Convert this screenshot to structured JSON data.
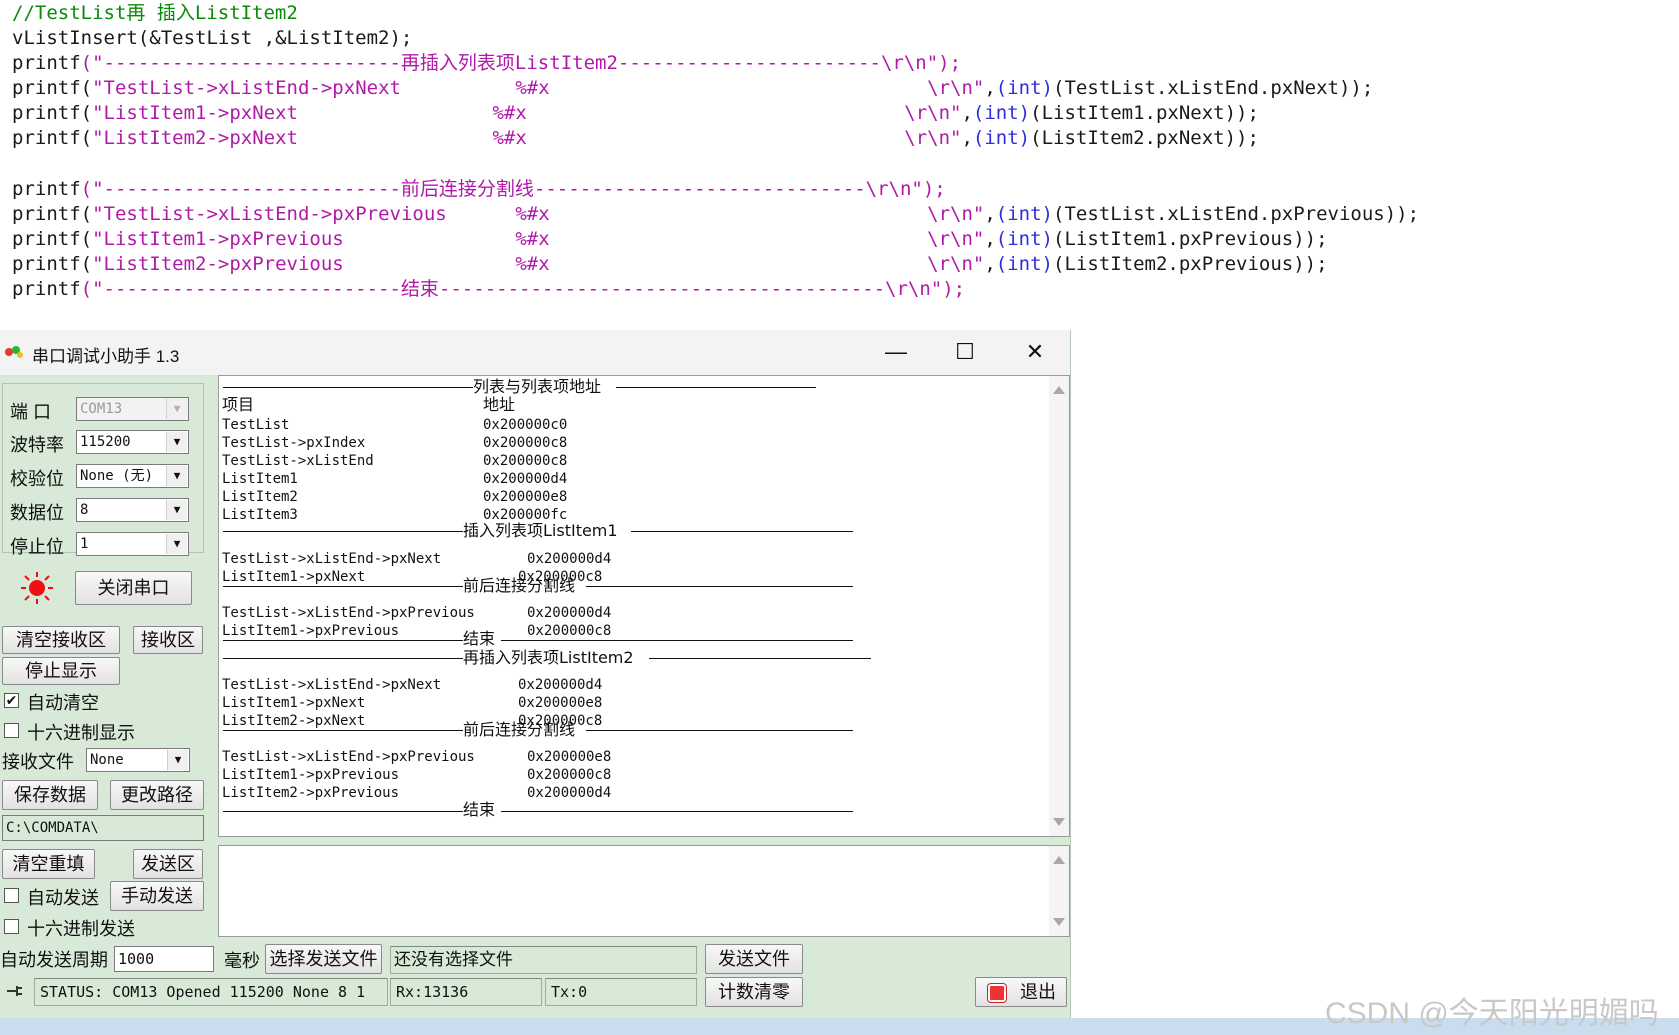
{
  "code": {
    "comment": "//TestList再 插入ListItem2",
    "insert_line": "vListInsert(&TestList ,&ListItem2);",
    "printf": "printf",
    "header_insert2": "(\"--------------------------再插入列表项ListItem2-----------------------\\r\\n\");",
    "l1_str": "\"TestList->xListEnd->pxNext          %#x                                 \\r\\n\"",
    "l1_tail": "(TestList.xListEnd.pxNext));",
    "l2_str": "\"ListItem1->pxNext                 %#x                                 \\r\\n\"",
    "l2_tail": "(ListItem1.pxNext));",
    "l3_str": "\"ListItem2->pxNext                 %#x                                 \\r\\n\"",
    "l3_tail": "(ListItem2.pxNext));",
    "header_sep": "(\"--------------------------前后连接分割线-----------------------------\\r\\n\");",
    "p1_str": "\"TestList->xListEnd->pxPrevious      %#x                                 \\r\\n\"",
    "p1_tail": "(TestList.xListEnd.pxPrevious));",
    "p2_str": "\"ListItem1->pxPrevious               %#x                                 \\r\\n\"",
    "p2_tail": "(ListItem1.pxPrevious));",
    "p3_str": "\"ListItem2->pxPrevious               %#x                                 \\r\\n\"",
    "p3_tail": "(ListItem2.pxPrevious));",
    "footer": "(\"--------------------------结束---------------------------------------\\r\\n\");",
    "int_kw": "(int)",
    "comma": ",",
    "open_paren": "("
  },
  "window": {
    "title": "串口调试小助手 1.3",
    "minimize": "—",
    "maximize": "☐",
    "close": "✕"
  },
  "settings": {
    "port_label": "端  口",
    "port_value": "COM13",
    "baud_label": "波特率",
    "baud_value": "115200",
    "parity_label": "校验位",
    "parity_value": "None (无)",
    "databits_label": "数据位",
    "databits_value": "8",
    "stopbits_label": "停止位",
    "stopbits_value": "1",
    "close_port_button": "关闭串口"
  },
  "receive_controls": {
    "clear_button": "清空接收区",
    "area_button": "接收区",
    "stop_display_button": "停止显示",
    "auto_clear_label": "自动清空",
    "auto_clear_checked": "✔",
    "hex_display_label": "十六进制显示",
    "recv_file_label": "接收文件",
    "recv_file_value": "None",
    "save_data_button": "保存数据",
    "change_path_button": "更改路径",
    "path_value": "C:\\COMDATA\\"
  },
  "receive_area": {
    "h_list": "列表与列表项地址",
    "col_item": "项目",
    "col_addr": "地址",
    "rows1": [
      {
        "k": "TestList",
        "v": "0x200000c0"
      },
      {
        "k": "TestList->pxIndex",
        "v": "0x200000c8"
      },
      {
        "k": "TestList->xListEnd",
        "v": "0x200000c8"
      },
      {
        "k": "ListItem1",
        "v": "0x200000d4"
      },
      {
        "k": "ListItem2",
        "v": "0x200000e8"
      },
      {
        "k": "ListItem3",
        "v": "0x200000fc"
      }
    ],
    "h_insert1": "插入列表项ListItem1",
    "rows2": [
      {
        "k": "TestList->xListEnd->pxNext",
        "v": "0x200000d4"
      },
      {
        "k": "ListItem1->pxNext",
        "v": "0x200000c8"
      }
    ],
    "h_sep1": "前后连接分割线",
    "rows3": [
      {
        "k": "TestList->xListEnd->pxPrevious",
        "v": "0x200000d4"
      },
      {
        "k": "ListItem1->pxPrevious",
        "v": "0x200000c8"
      }
    ],
    "h_end1": "结束",
    "h_insert2": "再插入列表项ListItem2",
    "rows4": [
      {
        "k": "TestList->xListEnd->pxNext",
        "v": "0x200000d4"
      },
      {
        "k": "ListItem1->pxNext",
        "v": "0x200000e8"
      },
      {
        "k": "ListItem2->pxNext",
        "v": "0x200000c8"
      }
    ],
    "h_sep2": "前后连接分割线",
    "rows5": [
      {
        "k": "TestList->xListEnd->pxPrevious",
        "v": "0x200000e8"
      },
      {
        "k": "ListItem1->pxPrevious",
        "v": "0x200000c8"
      },
      {
        "k": "ListItem2->pxPrevious",
        "v": "0x200000d4"
      }
    ],
    "h_end2": "结束"
  },
  "send_controls": {
    "clear_resend_button": "清空重填",
    "send_area_button": "发送区",
    "auto_send_label": "自动发送",
    "manual_send_button": "手动发送",
    "hex_send_label": "十六进制发送",
    "period_label": "自动发送周期",
    "period_value": "1000",
    "ms_label": "毫秒",
    "choose_file_button": "选择发送文件",
    "no_file_text": "还没有选择文件",
    "send_file_button": "发送文件",
    "reset_count_button": "计数清零",
    "exit_button": "退出"
  },
  "status": {
    "status_text": "STATUS: COM13 Opened 115200 None  8 1",
    "rx_text": "Rx:13136",
    "tx_text": "Tx:0"
  },
  "watermark": "CSDN @今天阳光明媚吗",
  "colors": {
    "comment": "#0a8a0a",
    "string": "#b01aa8",
    "keyword": "#2d2de0",
    "window_bg": "#d8e9d8"
  }
}
